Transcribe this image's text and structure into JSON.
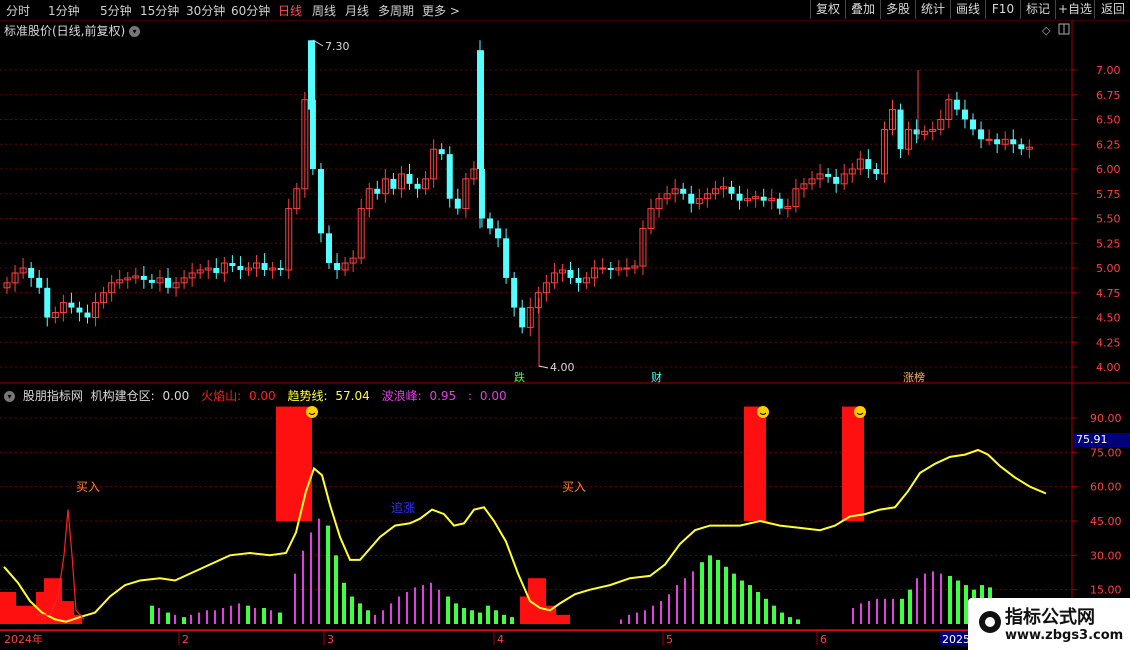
{
  "toolbar": {
    "left_items": [
      "分时",
      "1分钟",
      "5分钟",
      "15分钟",
      "30分钟",
      "60分钟",
      "日线",
      "周线",
      "月线",
      "多周期",
      "更多 >"
    ],
    "active_item": "日线",
    "right_buttons": [
      "复权",
      "叠加",
      "多股",
      "统计",
      "画线",
      "F10",
      "标记",
      "+自选",
      "返回"
    ]
  },
  "main_chart": {
    "title": "标准股价(日线,前复权)",
    "y_ticks": [
      "7.00",
      "6.75",
      "6.50",
      "6.25",
      "6.00",
      "5.75",
      "5.50",
      "5.25",
      "5.00",
      "4.75",
      "4.50",
      "4.25",
      "4.00"
    ],
    "high_label": "7.30",
    "low_label": "4.00",
    "markers": [
      "跌",
      "财",
      "涨榜"
    ]
  },
  "indicator": {
    "name": "股朋指标网",
    "items": [
      {
        "label": "机构建仓区:",
        "value": "0.00",
        "color": "#d8d8d8"
      },
      {
        "label": "火焰山:",
        "value": "0.00",
        "color": "#ff2020"
      },
      {
        "label": "趋势线:",
        "value": "57.04",
        "color": "#ffff30"
      },
      {
        "label": "波浪峰:",
        "value": "0.95",
        "color": "#e040e0"
      },
      {
        "label": ":",
        "value": "0.00",
        "color": "#e040e0"
      }
    ],
    "y_ticks": [
      "90.00",
      "75.00",
      "60.00",
      "45.00",
      "30.00",
      "15.00"
    ],
    "current_value": "75.91",
    "annotations": [
      "买入",
      "追涨",
      "买入"
    ]
  },
  "x_axis": {
    "labels": [
      "2024年",
      "2",
      "3",
      "4",
      "5",
      "6",
      "2025/"
    ]
  },
  "watermark": {
    "name": "指标公式网",
    "url": "www.zbgs3.com"
  },
  "colors": {
    "up": "#ff4040",
    "down": "#54ffff",
    "trend": "#ffff30",
    "wave": "#e040e0",
    "green_bar": "#40ff40",
    "fire": "#ff1010",
    "grid": "#6a0000"
  }
}
